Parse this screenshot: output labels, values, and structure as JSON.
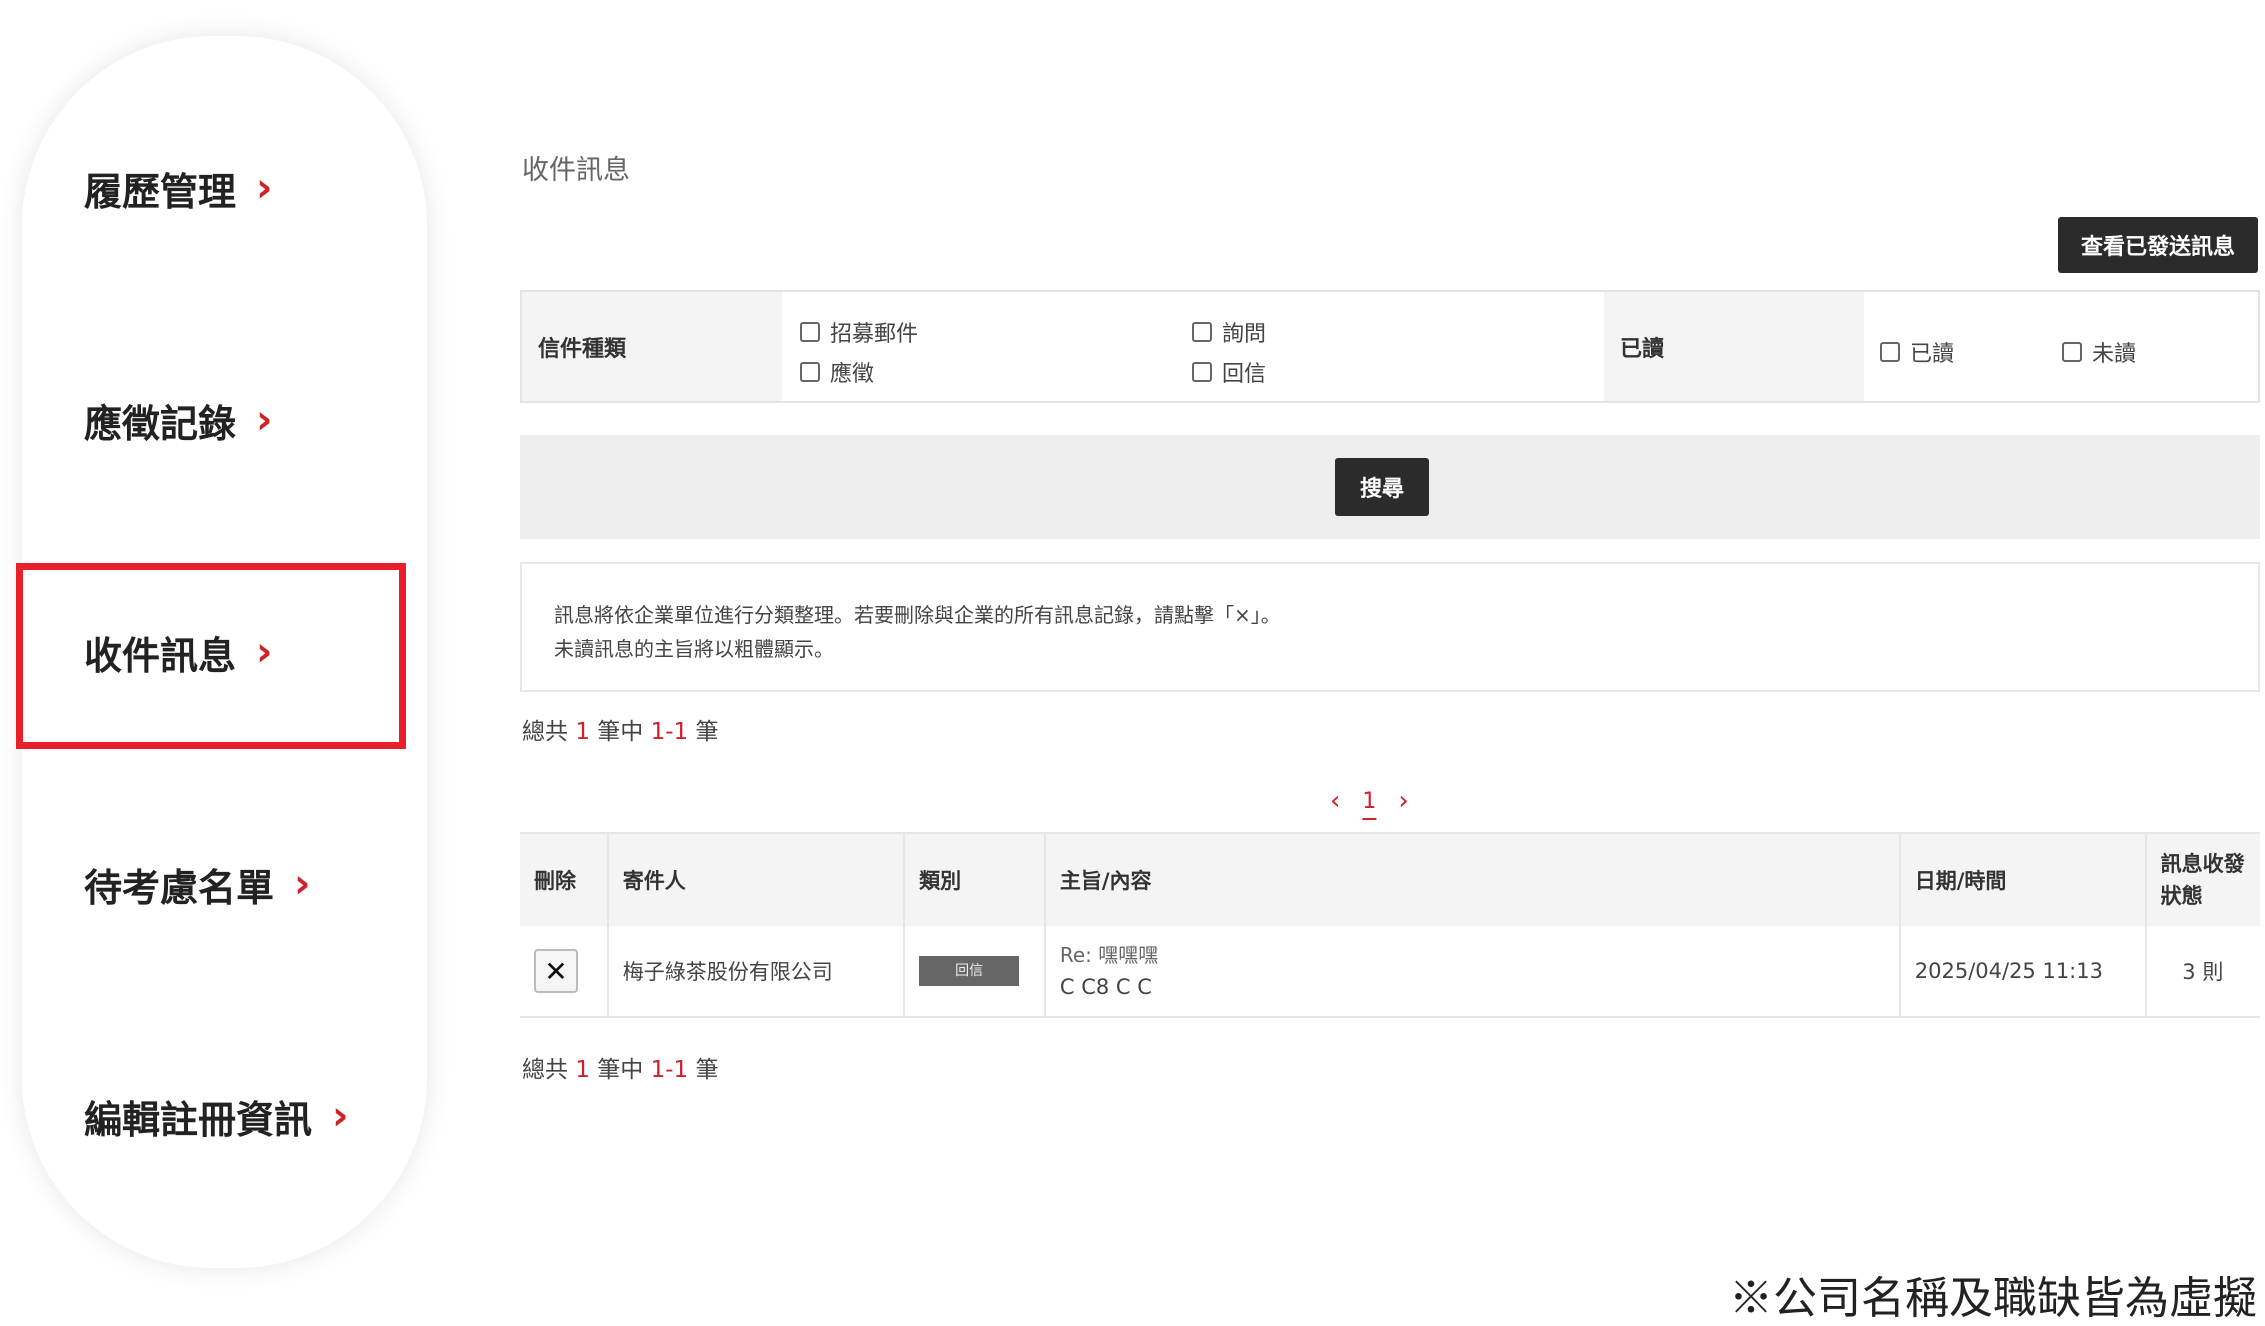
{
  "sidebar": {
    "items": [
      {
        "label": "履歷管理"
      },
      {
        "label": "應徵記錄"
      },
      {
        "label": "收件訊息"
      },
      {
        "label": "待考慮名單"
      },
      {
        "label": "編輯註冊資訊"
      }
    ],
    "chevron": "›",
    "highlight_color": "#e8202a"
  },
  "main": {
    "title": "收件訊息",
    "sent_button": "查看已發送訊息",
    "filter": {
      "type_label": "信件種類",
      "type_options": [
        "招募郵件",
        "詢問",
        "應徵",
        "回信"
      ],
      "read_label": "已讀",
      "read_options": [
        "已讀",
        "未讀"
      ]
    },
    "search_button": "搜尋",
    "notice": [
      "訊息將依企業單位進行分類整理。若要刪除與企業的所有訊息記錄，請點擊「×」。",
      "未讀訊息的主旨將以粗體顯示。"
    ],
    "total": {
      "prefix": "總共",
      "count": "1",
      "mid": "筆中",
      "range": "1-1",
      "suffix": "筆"
    },
    "pager": {
      "prev": "‹",
      "page": "1",
      "next": "›"
    },
    "table": {
      "headers": [
        "刪除",
        "寄件人",
        "類別",
        "主旨/內容",
        "日期/時間",
        "訊息收發狀態"
      ],
      "rows": [
        {
          "delete": "✕",
          "sender": "梅子綠茶股份有限公司",
          "category": "回信",
          "subject": "Re: 嘿嘿嘿",
          "content": "C C8 C C",
          "datetime": "2025/04/25 11:13",
          "status": "3 則"
        }
      ]
    }
  },
  "footnote": "※公司名稱及職缺皆為虛擬"
}
